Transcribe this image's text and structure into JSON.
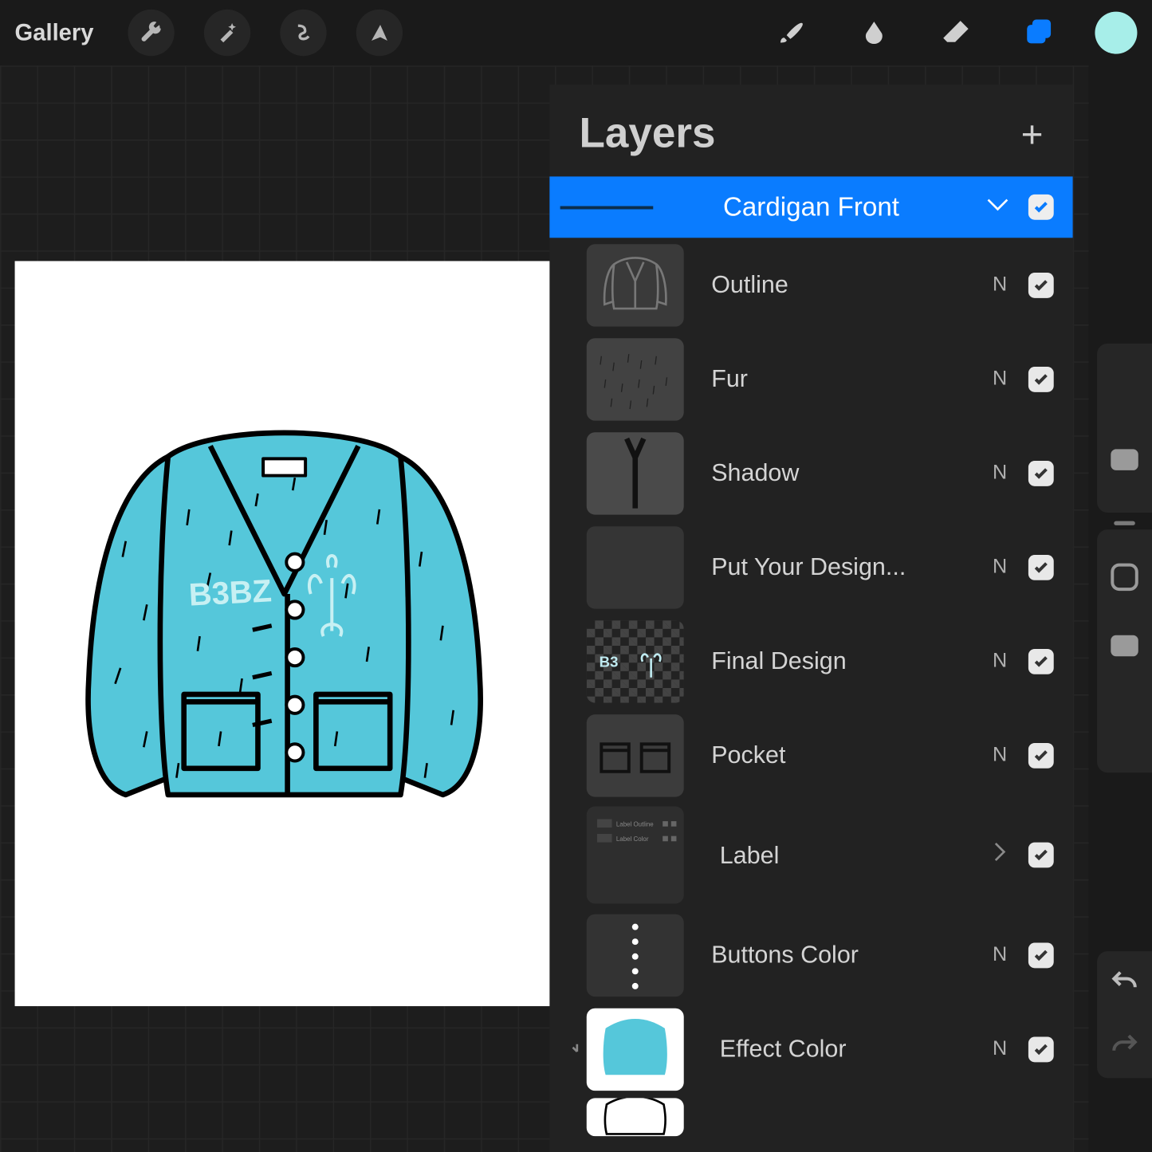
{
  "topbar": {
    "gallery_label": "Gallery"
  },
  "panel": {
    "title": "Layers",
    "group": {
      "name": "Cardigan Front"
    },
    "layers": [
      {
        "name": "Outline",
        "blend": "N"
      },
      {
        "name": "Fur",
        "blend": "N"
      },
      {
        "name": "Shadow",
        "blend": "N"
      },
      {
        "name": "Put Your Design...",
        "blend": "N"
      },
      {
        "name": "Final Design",
        "blend": "N"
      },
      {
        "name": "Pocket",
        "blend": "N"
      },
      {
        "name": "Label",
        "blend": ""
      },
      {
        "name": "Buttons Color",
        "blend": "N"
      },
      {
        "name": "Effect Color",
        "blend": "N"
      }
    ]
  },
  "colors": {
    "accent": "#0a7cff",
    "swatch": "#a7eee9",
    "cardigan": "#55c7da"
  }
}
